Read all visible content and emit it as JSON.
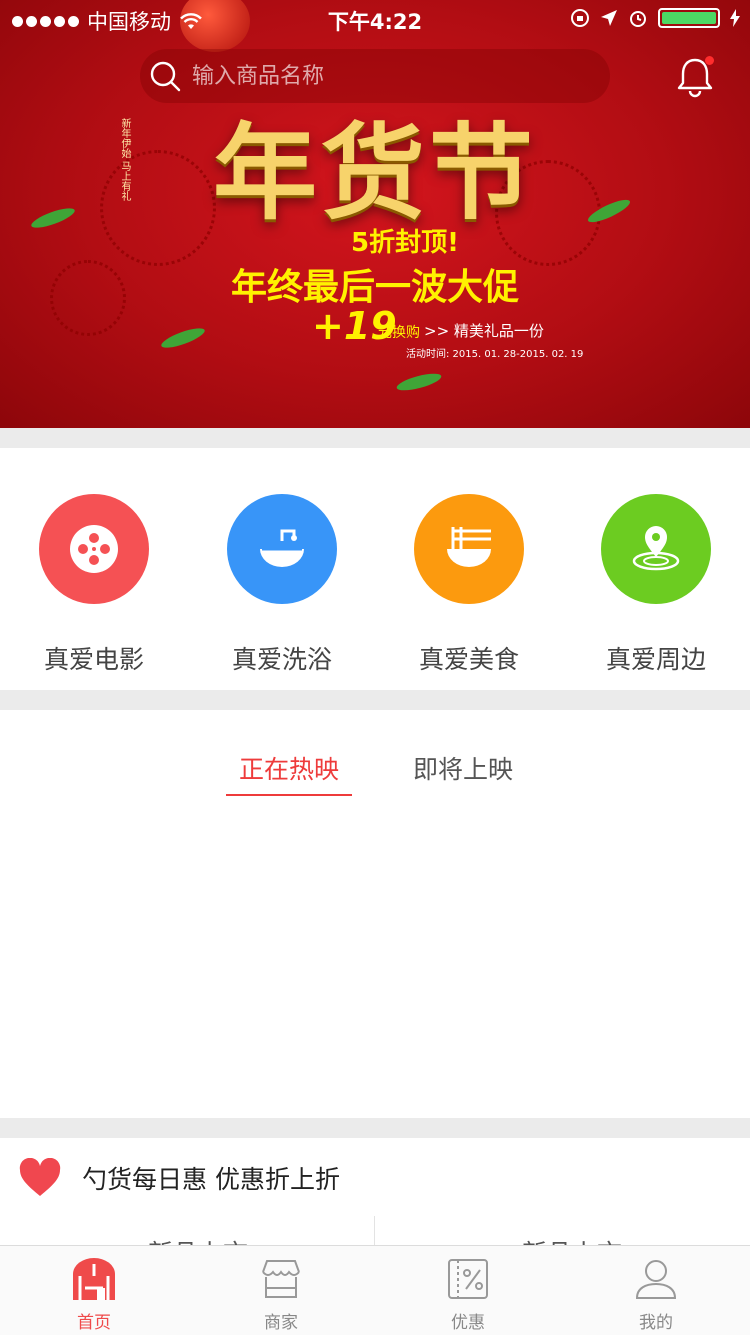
{
  "status_bar": {
    "carrier": "中国移动",
    "time": "下午4:22"
  },
  "search": {
    "placeholder": "输入商品名称"
  },
  "banner": {
    "title": "年货节",
    "subtitle": "5折封顶!",
    "headline": "年终最后一波大促",
    "promo": "+19",
    "promo_unit": "元换购",
    "gift": ">> 精美礼品一份",
    "date": "活动时间: 2015. 01. 28-2015. 02. 19",
    "side_text": "新年伊始 马上有礼"
  },
  "categories": [
    {
      "label": "真爱电影",
      "icon": "film-reel-icon",
      "color": "#f55154"
    },
    {
      "label": "真爱洗浴",
      "icon": "shower-bath-icon",
      "color": "#3895f8"
    },
    {
      "label": "真爱美食",
      "icon": "noodle-bowl-icon",
      "color": "#fc9a0e"
    },
    {
      "label": "真爱周边",
      "icon": "location-pin-icon",
      "color": "#6ccc21"
    }
  ],
  "movie_tabs": {
    "active": "正在热映",
    "inactive": "即将上映"
  },
  "deals": {
    "title": "勺货每日惠 优惠折上折",
    "items": [
      "新品上市",
      "新品上市"
    ]
  },
  "tab_bar": [
    {
      "label": "首页",
      "icon": "home-icon",
      "active": true
    },
    {
      "label": "商家",
      "icon": "store-icon",
      "active": false
    },
    {
      "label": "优惠",
      "icon": "discount-icon",
      "active": false
    },
    {
      "label": "我的",
      "icon": "user-icon",
      "active": false
    }
  ],
  "colors": {
    "accent": "#ef4a4a",
    "banner_red": "#c0121a",
    "divider": "#ebebeb"
  }
}
